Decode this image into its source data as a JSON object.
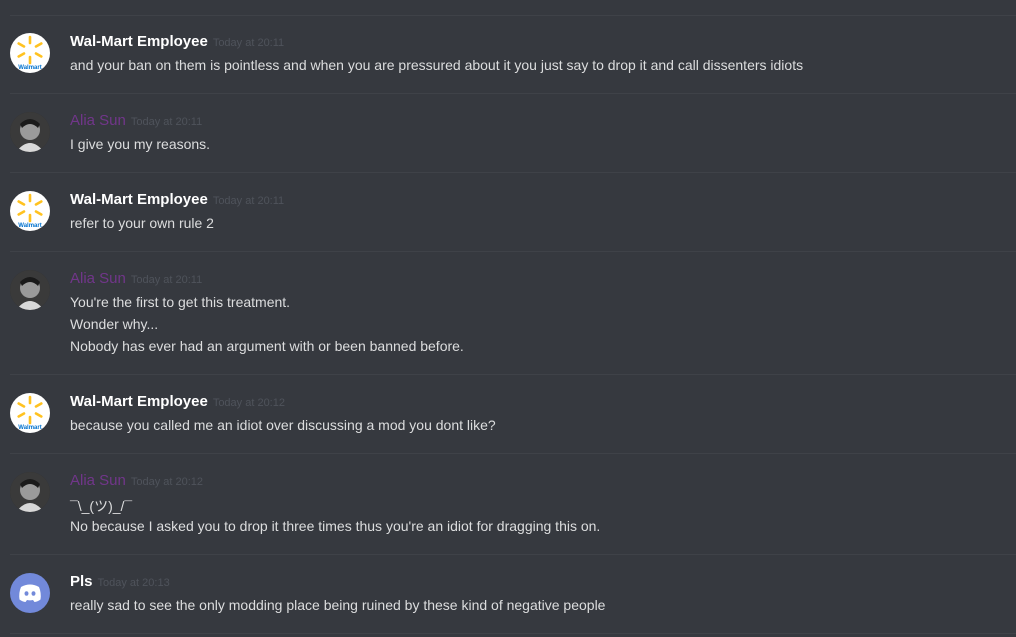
{
  "messages": [
    {
      "author": "Wal-Mart Employee",
      "timestamp": "Today at 20:11",
      "avatar_icon": "walmart-logo",
      "lines": [
        "and your ban on them is pointless and when you are pressured about it you just say to drop it and call dissenters idiots"
      ]
    },
    {
      "author": "Alia Sun",
      "timestamp": "Today at 20:11",
      "avatar_icon": "user-photo",
      "author_color": "#71368a",
      "lines": [
        "I give you my reasons."
      ]
    },
    {
      "author": "Wal-Mart Employee",
      "timestamp": "Today at 20:11",
      "avatar_icon": "walmart-logo",
      "lines": [
        "refer to your own rule 2"
      ]
    },
    {
      "author": "Alia Sun",
      "timestamp": "Today at 20:11",
      "avatar_icon": "user-photo",
      "author_color": "#71368a",
      "lines": [
        "You're the first to get this treatment.",
        "Wonder why...",
        "Nobody has ever had an argument with or been banned before."
      ]
    },
    {
      "author": "Wal-Mart Employee",
      "timestamp": "Today at 20:12",
      "avatar_icon": "walmart-logo",
      "lines": [
        "because you called me an idiot over discussing a mod you dont like?"
      ]
    },
    {
      "author": "Alia Sun",
      "timestamp": "Today at 20:12",
      "avatar_icon": "user-photo",
      "author_color": "#71368a",
      "lines": [
        "¯\\_(ツ)_/¯",
        "No because I asked you to drop it three times thus you're an idiot for dragging this on."
      ]
    },
    {
      "author": "Pls",
      "timestamp": "Today at 20:13",
      "avatar_icon": "discord-logo",
      "lines": [
        "really sad to see the only modding place being ruined by these kind of negative people"
      ]
    }
  ],
  "walmart_avatar_text": "Walmart",
  "colors": {
    "background": "#36393f",
    "text": "#dcddde",
    "timestamp": "#4f535b",
    "walmart_blue": "#0071ce",
    "walmart_yellow": "#ffc220",
    "discord_blurple": "#7289da"
  }
}
